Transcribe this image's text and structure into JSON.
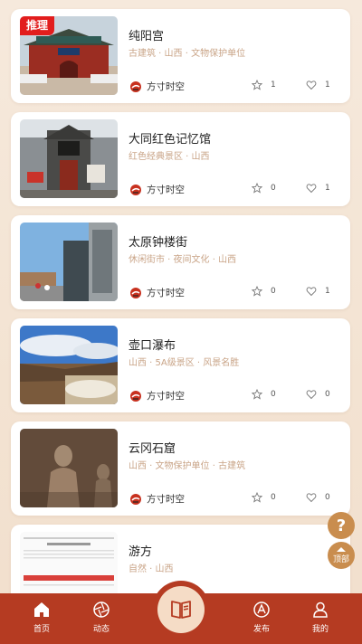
{
  "badge_label": "推理",
  "cards": [
    {
      "title": "纯阳宫",
      "tags": "古建筑 · 山西 · 文物保护单位",
      "author": "方寸时空",
      "stars": "1",
      "likes": "1",
      "image": "temple-gate-image"
    },
    {
      "title": "大同红色记忆馆",
      "tags": "红色经典景区 · 山西",
      "author": "方寸时空",
      "stars": "0",
      "likes": "1",
      "image": "memorial-hall-image"
    },
    {
      "title": "太原钟楼街",
      "tags": "休闲街市 · 夜间文化 · 山西",
      "author": "方寸时空",
      "stars": "0",
      "likes": "1",
      "image": "street-image"
    },
    {
      "title": "壶口瀑布",
      "tags": "山西 · 5A级景区 · 风景名胜",
      "author": "方寸时空",
      "stars": "0",
      "likes": "0",
      "image": "waterfall-image"
    },
    {
      "title": "云冈石窟",
      "tags": "山西 · 文物保护单位 · 古建筑",
      "author": "方寸时空",
      "stars": "0",
      "likes": "0",
      "image": "grottoes-image"
    },
    {
      "title": "游方",
      "tags": "自然 · 山西",
      "author": "",
      "stars": "",
      "likes": "",
      "image": "document-image"
    }
  ],
  "float": {
    "help": "?",
    "top": "顶部"
  },
  "tabbar": [
    {
      "label": "首页",
      "icon": "home-icon"
    },
    {
      "label": "动态",
      "icon": "aperture-icon"
    },
    {
      "label": "",
      "icon": "book-icon"
    },
    {
      "label": "发布",
      "icon": "publish-icon"
    },
    {
      "label": "我的",
      "icon": "user-icon"
    }
  ],
  "colors": {
    "accent": "#b53b22",
    "tag": "#c9a487",
    "badge": "#e21d1d",
    "float": "#c98d4e"
  }
}
